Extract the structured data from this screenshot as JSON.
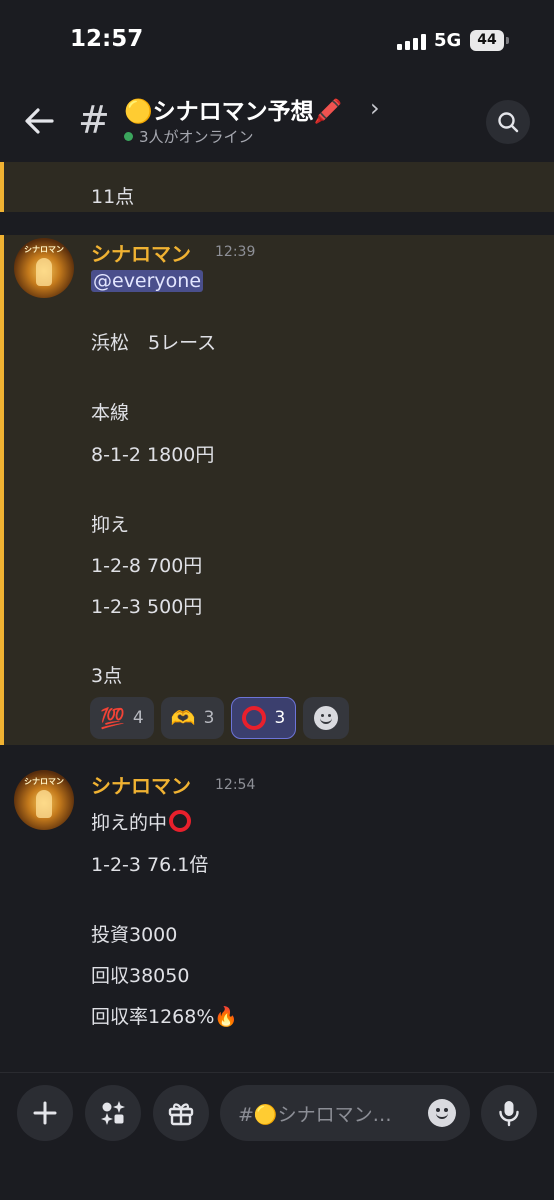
{
  "status": {
    "time": "12:57",
    "network": "5G",
    "battery": "44"
  },
  "header": {
    "channel_emoji": "🟡",
    "channel_name": "シナロマン予想",
    "channel_trailing_emoji": "🖍️",
    "online_text": "3人がオンライン"
  },
  "messages": {
    "prev_tail": "11点",
    "post1": {
      "author": "シナロマン",
      "time": "12:39",
      "mention": "@everyone",
      "lines": [
        "浜松　5レース",
        "本線",
        "8-1-2  1800円",
        "抑え",
        "1-2-8  700円",
        "1-2-3  500円",
        "3点"
      ],
      "reactions": [
        {
          "emoji": "💯",
          "count": "4"
        },
        {
          "emoji": "🫶",
          "count": "3"
        },
        {
          "emoji": "⭕",
          "count": "3"
        }
      ]
    },
    "post2": {
      "author": "シナロマン",
      "time": "12:54",
      "line1": "抑え的中",
      "lines": [
        "1-2-3  76.1倍",
        "投資3000",
        "回収38050",
        "回収率1268%🔥"
      ]
    }
  },
  "composer": {
    "placeholder": "#🟡シナロマン…"
  },
  "colors": {
    "accent": "#f0b232",
    "mention_bg": "#4a4f8c",
    "background": "#1b1c21"
  }
}
